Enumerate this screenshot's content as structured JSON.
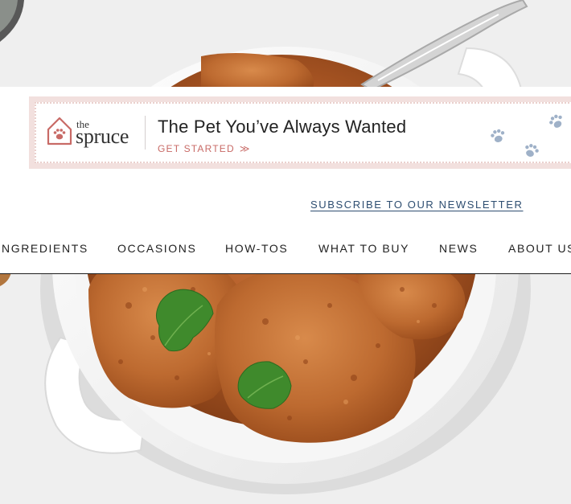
{
  "ad": {
    "logo_the": "the",
    "logo_spruce": "spruce",
    "headline": "The Pet You’ve Always Wanted",
    "cta_label": "GET STARTED",
    "cta_arrow": "≫",
    "accent_color": "#c86a66",
    "frame_color": "#f2e0de",
    "paw_color": "#9fb1c8"
  },
  "newsletter": {
    "label": "SUBSCRIBE TO OUR NEWSLETTER"
  },
  "nav": {
    "items": [
      {
        "label": "NGREDIENTS"
      },
      {
        "label": "OCCASIONS"
      },
      {
        "label": "HOW-TOS"
      },
      {
        "label": "WHAT TO BUY"
      },
      {
        "label": "NEWS"
      },
      {
        "label": "ABOUT US"
      }
    ]
  },
  "icons": {
    "logo": "house-paw-icon",
    "decoration": "paw-print-icon"
  }
}
